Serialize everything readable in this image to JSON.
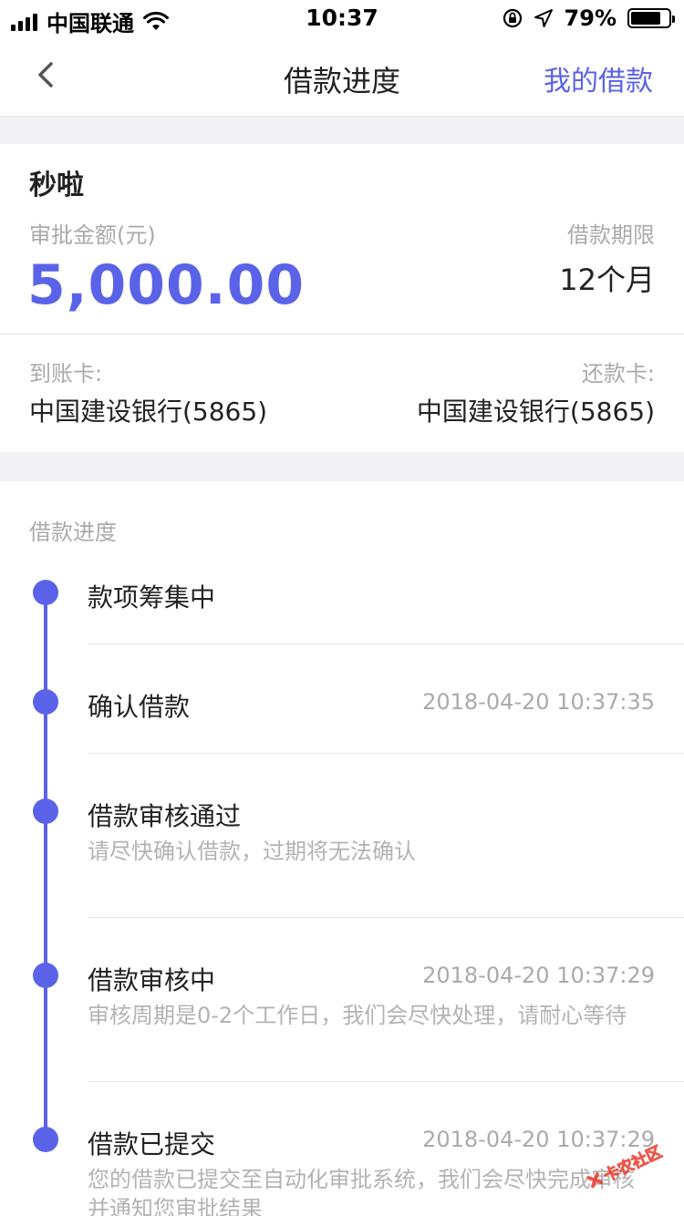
{
  "status_bar": {
    "carrier": "中国联通",
    "time": "10:37",
    "battery_percent": "79%",
    "battery_level": 0.79
  },
  "nav": {
    "title": "借款进度",
    "right_link": "我的借款"
  },
  "loan": {
    "product_name": "秒啦",
    "amount_label": "审批金额(元)",
    "amount": "5,000.00",
    "term_label": "借款期限",
    "term": "12个月",
    "receive_card_label": "到账卡:",
    "receive_card": "中国建设银行(5865)",
    "repay_card_label": "还款卡:",
    "repay_card": "中国建设银行(5865)"
  },
  "progress": {
    "section_title": "借款进度",
    "steps": [
      {
        "title": "款项筹集中",
        "time": "",
        "desc": ""
      },
      {
        "title": "确认借款",
        "time": "2018-04-20 10:37:35",
        "desc": ""
      },
      {
        "title": "借款审核通过",
        "time": "",
        "desc": "请尽快确认借款，过期将无法确认"
      },
      {
        "title": "借款审核中",
        "time": "2018-04-20 10:37:29",
        "desc": "审核周期是0-2个工作日，我们会尽快处理，请耐心等待"
      },
      {
        "title": "借款已提交",
        "time": "2018-04-20 10:37:29",
        "desc": "您的借款已提交至自动化审批系统，我们会尽快完成审核并通知您审批结果"
      }
    ]
  },
  "colors": {
    "accent": "#5a63e8",
    "muted": "#aaaaaa",
    "background": "#f3f3f5"
  },
  "watermark": {
    "text": "卡农社区"
  }
}
